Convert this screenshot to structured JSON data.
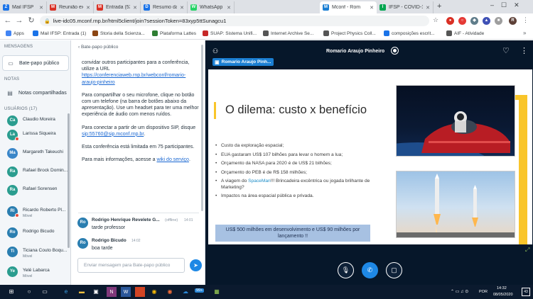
{
  "browser": {
    "tabs": [
      {
        "label": "Mail IFSP",
        "icon": "Z",
        "color": "#1a73e8"
      },
      {
        "label": "Reunião extraordi",
        "icon": "M",
        "color": "#d93025"
      },
      {
        "label": "Entrada (539) - ai",
        "icon": "M",
        "color": "#d93025"
      },
      {
        "label": "Resumo da reuniã",
        "icon": "D",
        "color": "#1a73e8"
      },
      {
        "label": "WhatsApp",
        "icon": "W",
        "color": "#25d366"
      },
      {
        "label": "Mconf - Rom",
        "icon": "M",
        "color": "#1b7fd3"
      },
      {
        "label": "IFSP - COVID-19 -",
        "icon": "I",
        "color": "#00a651"
      }
    ],
    "new_tab": "+",
    "url": "live-idc05.mconf.rnp.br/html5client/join?sessionToken=83xyp5ttSunagcu1",
    "bookmarks": [
      {
        "label": "Apps",
        "color": "#4285f4"
      },
      {
        "label": "Mail IFSP: Entrada (1)",
        "color": "#1a73e8"
      },
      {
        "label": "Storia della Scienza...",
        "color": "#8b4513"
      },
      {
        "label": "Plataforma Lattes",
        "color": "#2e7d32"
      },
      {
        "label": "SUAP: Sistema Unifi...",
        "color": "#c62828"
      },
      {
        "label": "Internet Archive Se...",
        "color": "#555555"
      },
      {
        "label": "Project Physics Coll...",
        "color": "#555555"
      },
      {
        "label": "composições escrit...",
        "color": "#1a73e8"
      },
      {
        "label": "AIF - Atividade",
        "color": "#555555"
      }
    ]
  },
  "sidebar": {
    "messages_header": "MENSAGENS",
    "public_chat": "Bate-papo público",
    "notes_header": "NOTAS",
    "shared_notes": "Notas compartilhadas",
    "users_header": "USUÁRIOS (17)",
    "users": [
      {
        "initials": "Ca",
        "name": "Claudio Moreira",
        "sub": ""
      },
      {
        "initials": "La",
        "name": "Larissa Siqueira",
        "sub": ""
      },
      {
        "initials": "Ma",
        "name": "Margareth Takeuchi",
        "sub": ""
      },
      {
        "initials": "Ra",
        "name": "Rafael Brock Domin...",
        "sub": ""
      },
      {
        "initials": "Ra",
        "name": "Rafael Sorensen",
        "sub": ""
      },
      {
        "initials": "Ri",
        "name": "Ricardo Roberto Pl...",
        "sub": "Móvel"
      },
      {
        "initials": "Ro",
        "name": "Rodrigo Bicudo",
        "sub": ""
      },
      {
        "initials": "Ti",
        "name": "Ticiana Couto Boqu...",
        "sub": "Móvel"
      },
      {
        "initials": "Ye",
        "name": "Yelé Labarca",
        "sub": "Móvel"
      }
    ]
  },
  "chat": {
    "header": "‹ Bate-papo público",
    "welcome_p1": "convidar outros participantes para a conferência, utilize a URL",
    "welcome_link": "https://conferenciaweb.rnp.br/webconf/romario-araujo-pinheiro",
    "welcome_p2": "Para compartilhar o seu microfone, clique no botão com um telefone (na barra de botões abaixo da apresentação). Use um headset para ter uma melhor experiência de áudio com menos ruídos.",
    "welcome_p3_pre": "Para conectar a partir de um dispositivo SIP, disque ",
    "welcome_sip": "sip:55760@sip.mconf.rnp.br",
    "welcome_p3_post": ".",
    "welcome_p4": "Esta conferência está limitada em 75 participantes.",
    "welcome_p5_pre": "Para mais informações, acesse a ",
    "welcome_p5_link": "wiki do serviço",
    "welcome_p5_post": ".",
    "messages": [
      {
        "initials": "Ro",
        "name": "Rodrigo Henrique Revelete G...",
        "status": "(offline)",
        "time": "14:01",
        "text": "tarde professor"
      },
      {
        "initials": "Ro",
        "name": "Rodrigo Bicudo",
        "status": "",
        "time": "14:02",
        "text": "boa tarde"
      }
    ],
    "input_placeholder": "Enviar mensagem para Bate-papo público"
  },
  "presentation": {
    "presenter_name": "Romario Araujo Pinheiro",
    "presenter_badge": "Romario Araujo Pinh...",
    "slide": {
      "title": "O dilema: custo x benefício",
      "bullets": [
        "Custo da exploração espacial;",
        "EUA gastaram US$ 107 bilhões para levar o homem a lua;",
        "Orçamento da NASA para 2020 é de US$ 21 bilhões;",
        "Orçamento do PEB é de R$ 158 milhões;",
        "A viagem do ",
        "Impactos na área espacial pública e privada."
      ],
      "bullet5_highlight": "SpaceMan",
      "bullet5_rest": "!!! Brincadeira excêntrica ou jogada brilhante de Marketing?",
      "box_text": "US$ 500 milhões em desenvolvimento e US$ 90 milhões por lançamento !!"
    }
  },
  "taskbar": {
    "time": "14:32",
    "date": "08/05/2020",
    "lang": "POR",
    "notif_count": "43",
    "badge": "99+"
  }
}
